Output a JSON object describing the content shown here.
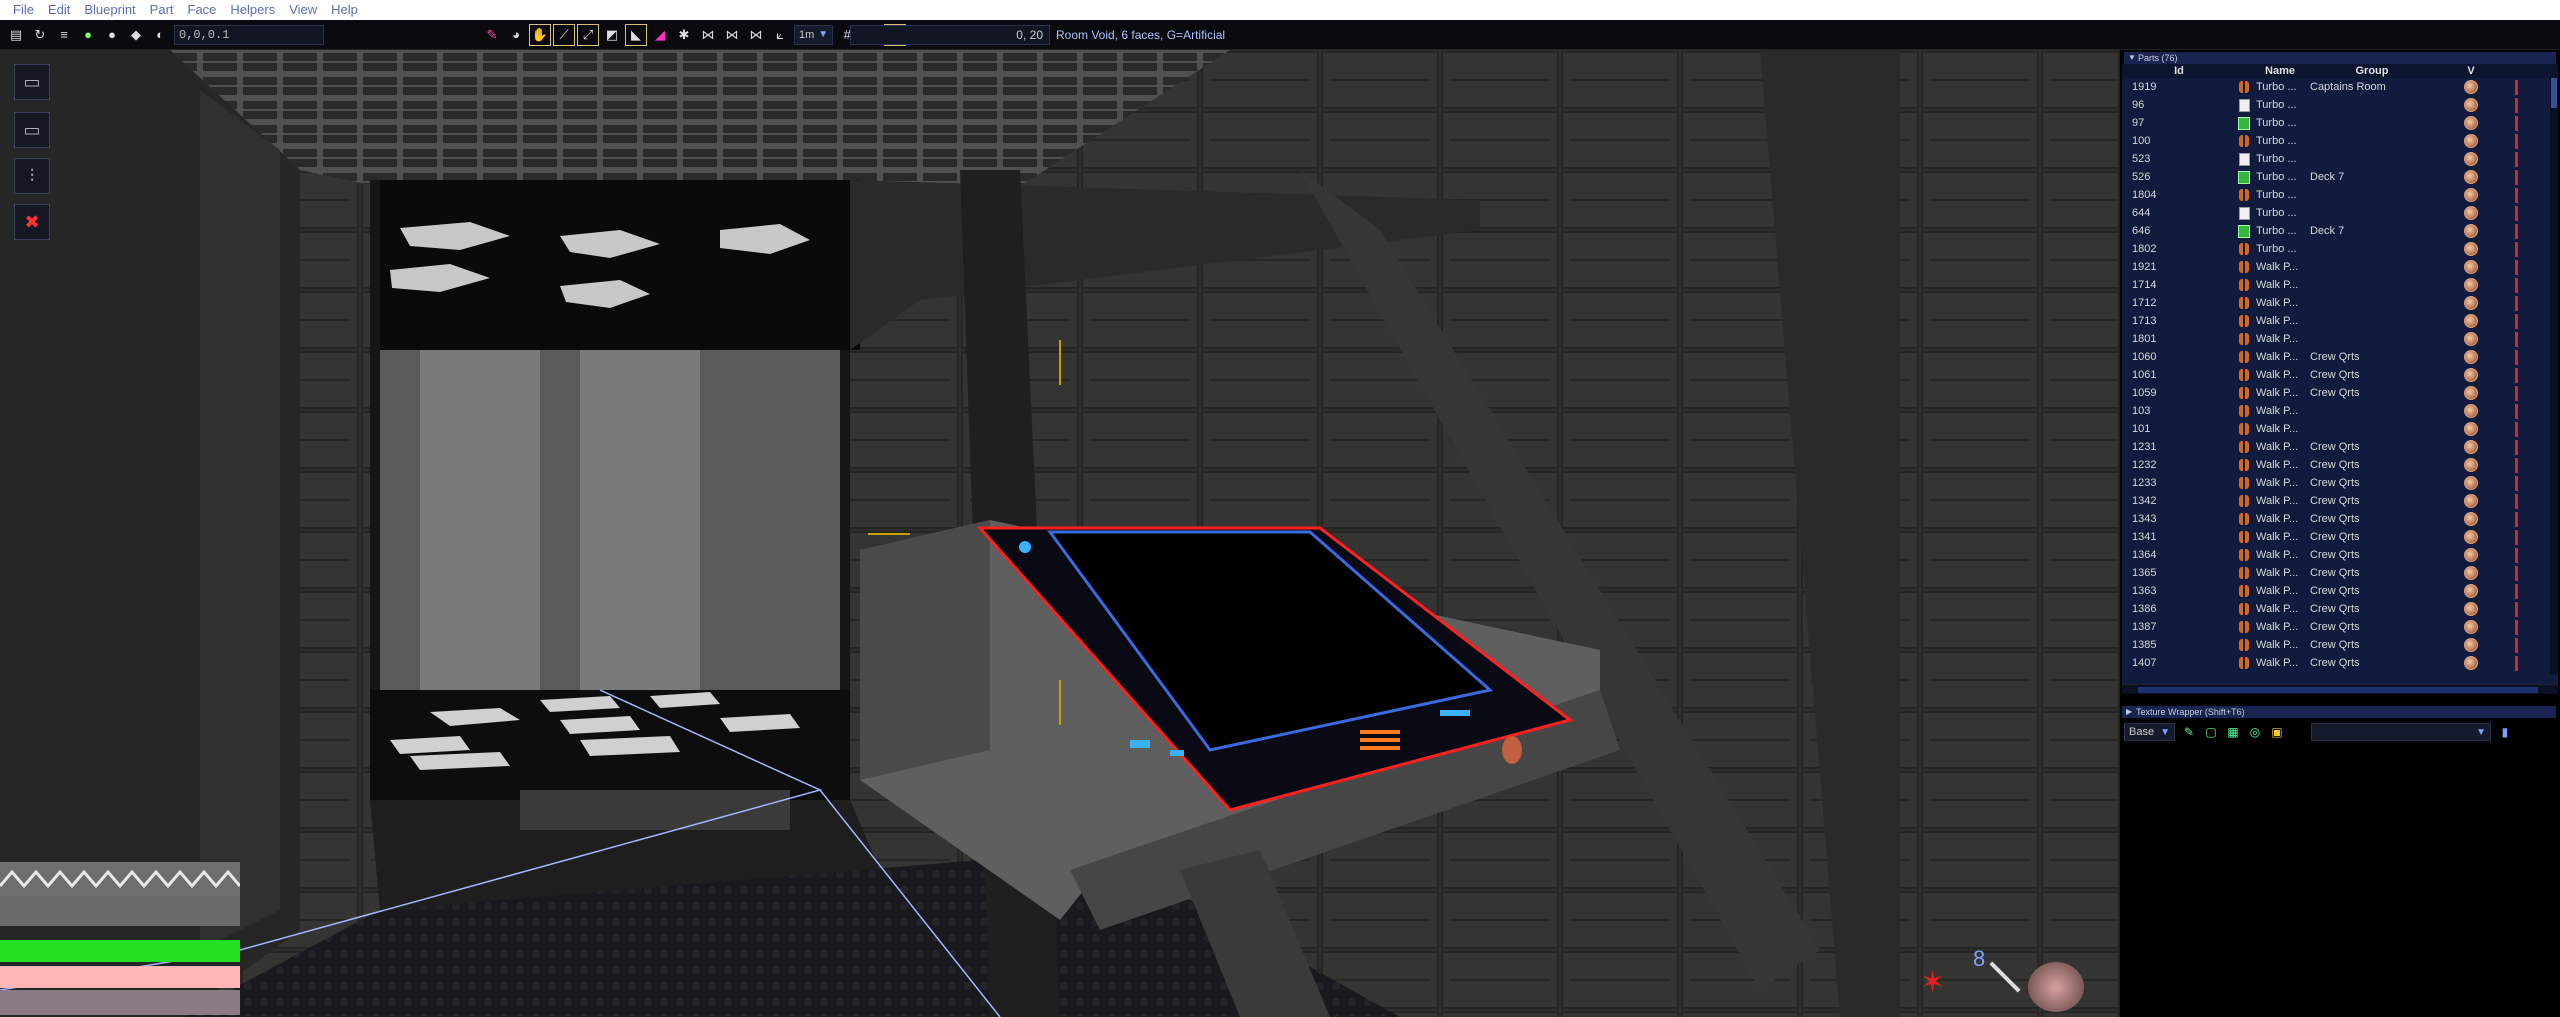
{
  "menu": [
    "File",
    "Edit",
    "Blueprint",
    "Part",
    "Face",
    "Helpers",
    "View",
    "Help"
  ],
  "toolbar": {
    "coord_value": "0,0,0.1",
    "grid_value": "1m",
    "position_readout": "0, 20",
    "status_text": "Room Void, 6 faces, G=Artificial"
  },
  "hud": {
    "cursor_count": "8"
  },
  "parts_panel": {
    "title": "Parts (76)",
    "columns": {
      "id": "Id",
      "name": "Name",
      "group": "Group",
      "v": "V"
    },
    "rows": [
      {
        "id": "1919",
        "icon": "feet",
        "name": "Turbo ...",
        "group": "Captains Room"
      },
      {
        "id": "96",
        "icon": "white",
        "name": "Turbo ...",
        "group": ""
      },
      {
        "id": "97",
        "icon": "green",
        "name": "Turbo ...",
        "group": ""
      },
      {
        "id": "100",
        "icon": "feet",
        "name": "Turbo ...",
        "group": ""
      },
      {
        "id": "523",
        "icon": "white",
        "name": "Turbo ...",
        "group": ""
      },
      {
        "id": "526",
        "icon": "green",
        "name": "Turbo ...",
        "group": "Deck 7"
      },
      {
        "id": "1804",
        "icon": "feet",
        "name": "Turbo ...",
        "group": ""
      },
      {
        "id": "644",
        "icon": "white",
        "name": "Turbo ...",
        "group": ""
      },
      {
        "id": "646",
        "icon": "green",
        "name": "Turbo ...",
        "group": "Deck 7"
      },
      {
        "id": "1802",
        "icon": "feet",
        "name": "Turbo ...",
        "group": ""
      },
      {
        "id": "1921",
        "icon": "feet",
        "name": "Walk P...",
        "group": ""
      },
      {
        "id": "1714",
        "icon": "feet",
        "name": "Walk P...",
        "group": ""
      },
      {
        "id": "1712",
        "icon": "feet",
        "name": "Walk P...",
        "group": ""
      },
      {
        "id": "1713",
        "icon": "feet",
        "name": "Walk P...",
        "group": ""
      },
      {
        "id": "1801",
        "icon": "feet",
        "name": "Walk P...",
        "group": ""
      },
      {
        "id": "1060",
        "icon": "feet",
        "name": "Walk P...",
        "group": "Crew Qrts"
      },
      {
        "id": "1061",
        "icon": "feet",
        "name": "Walk P...",
        "group": "Crew Qrts"
      },
      {
        "id": "1059",
        "icon": "feet",
        "name": "Walk P...",
        "group": "Crew Qrts"
      },
      {
        "id": "103",
        "icon": "feet",
        "name": "Walk P...",
        "group": ""
      },
      {
        "id": "101",
        "icon": "feet",
        "name": "Walk P...",
        "group": ""
      },
      {
        "id": "1231",
        "icon": "feet",
        "name": "Walk P...",
        "group": "Crew Qrts"
      },
      {
        "id": "1232",
        "icon": "feet",
        "name": "Walk P...",
        "group": "Crew Qrts"
      },
      {
        "id": "1233",
        "icon": "feet",
        "name": "Walk P...",
        "group": "Crew Qrts"
      },
      {
        "id": "1342",
        "icon": "feet",
        "name": "Walk P...",
        "group": "Crew Qrts"
      },
      {
        "id": "1343",
        "icon": "feet",
        "name": "Walk P...",
        "group": "Crew Qrts"
      },
      {
        "id": "1341",
        "icon": "feet",
        "name": "Walk P...",
        "group": "Crew Qrts"
      },
      {
        "id": "1364",
        "icon": "feet",
        "name": "Walk P...",
        "group": "Crew Qrts"
      },
      {
        "id": "1365",
        "icon": "feet",
        "name": "Walk P...",
        "group": "Crew Qrts"
      },
      {
        "id": "1363",
        "icon": "feet",
        "name": "Walk P...",
        "group": "Crew Qrts"
      },
      {
        "id": "1386",
        "icon": "feet",
        "name": "Walk P...",
        "group": "Crew Qrts"
      },
      {
        "id": "1387",
        "icon": "feet",
        "name": "Walk P...",
        "group": "Crew Qrts"
      },
      {
        "id": "1385",
        "icon": "feet",
        "name": "Walk P...",
        "group": "Crew Qrts"
      },
      {
        "id": "1407",
        "icon": "feet",
        "name": "Walk P...",
        "group": "Crew Qrts"
      }
    ]
  },
  "texture_panel": {
    "title": "Texture Wrapper (Shift+T6)",
    "mode": "Base"
  },
  "colors": {
    "menu_text": "#5a6fb0",
    "panel_bg": "#101b3e",
    "accent_blue": "#7fa0ff",
    "health_green": "#22e022",
    "pink_bar": "#ffb6b6"
  }
}
